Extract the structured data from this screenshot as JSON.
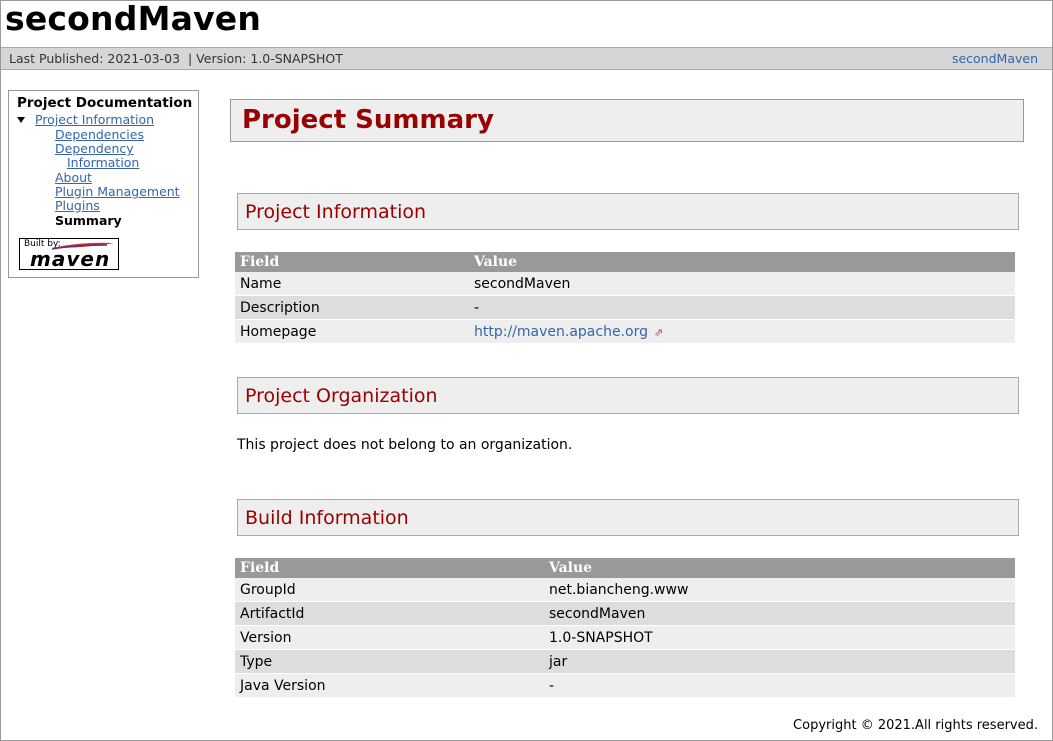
{
  "banner": {
    "project_name": "secondMaven"
  },
  "breadcrumbs": {
    "last_published_label": "Last Published: 2021-03-03",
    "version_label": "| Version: 1.0-SNAPSHOT",
    "right_link": "secondMaven"
  },
  "nav": {
    "heading": "Project Documentation",
    "items": [
      {
        "label": "Project Information"
      },
      {
        "label": "Dependencies"
      },
      {
        "label": "Dependency"
      },
      {
        "label": "Information"
      },
      {
        "label": "About"
      },
      {
        "label": "Plugin Management"
      },
      {
        "label": "Plugins"
      },
      {
        "label": "Summary"
      }
    ],
    "built_by_label": "Built by:",
    "built_by_logo": "maven"
  },
  "content": {
    "title": "Project Summary",
    "project_info": {
      "heading": "Project Information",
      "headers": [
        "Field",
        "Value"
      ],
      "rows": [
        [
          "Name",
          "secondMaven"
        ],
        [
          "Description",
          "-"
        ],
        [
          "Homepage",
          "http://maven.apache.org"
        ]
      ]
    },
    "organization": {
      "heading": "Project Organization",
      "text": "This project does not belong to an organization."
    },
    "build_info": {
      "heading": "Build Information",
      "headers": [
        "Field",
        "Value"
      ],
      "rows": [
        [
          "GroupId",
          "net.biancheng.www"
        ],
        [
          "ArtifactId",
          "secondMaven"
        ],
        [
          "Version",
          "1.0-SNAPSHOT"
        ],
        [
          "Type",
          "jar"
        ],
        [
          "Java Version",
          "-"
        ]
      ]
    }
  },
  "footer": {
    "copyright": "Copyright © 2021.All rights reserved."
  },
  "colors": {
    "accent": "#990000",
    "link": "#3366aa",
    "header_bg": "#999999",
    "row_a": "#eeeeee",
    "row_b": "#dddddd"
  }
}
